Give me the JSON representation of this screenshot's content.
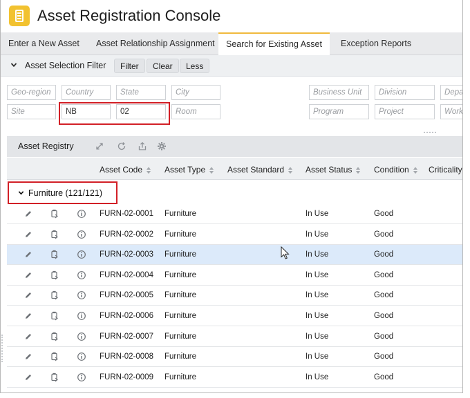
{
  "app": {
    "title": "Asset Registration Console",
    "logo_icon": "document-list-icon",
    "accent_color": "#f2c230"
  },
  "tabs": [
    {
      "label": "Enter a New Asset",
      "active": false
    },
    {
      "label": "Asset Relationship Assignment",
      "active": false
    },
    {
      "label": "Search for Existing Asset",
      "active": true
    },
    {
      "label": "Exception Reports",
      "active": false
    }
  ],
  "filter_bar": {
    "label": "Asset Selection Filter",
    "buttons": {
      "filter": "Filter",
      "clear": "Clear",
      "less": "Less"
    }
  },
  "filter_fields": {
    "geo_region": {
      "value": "",
      "placeholder": "Geo-region"
    },
    "country": {
      "value": "",
      "placeholder": "Country"
    },
    "state": {
      "value": "",
      "placeholder": "State"
    },
    "city": {
      "value": "",
      "placeholder": "City"
    },
    "business_unit": {
      "value": "",
      "placeholder": "Business Unit"
    },
    "division": {
      "value": "",
      "placeholder": "Division"
    },
    "department": {
      "value": "",
      "placeholder": "Depa"
    },
    "site": {
      "value": "",
      "placeholder": "Site"
    },
    "nb": {
      "value": "NB",
      "placeholder": ""
    },
    "code": {
      "value": "02",
      "placeholder": ""
    },
    "room": {
      "value": "",
      "placeholder": "Room"
    },
    "program": {
      "value": "",
      "placeholder": "Program"
    },
    "project": {
      "value": "",
      "placeholder": "Project"
    },
    "work": {
      "value": "",
      "placeholder": "Work"
    }
  },
  "grid": {
    "title": "Asset Registry",
    "toolbar_icons": [
      "expand-icon",
      "refresh-icon",
      "export-icon",
      "settings-gear-icon"
    ],
    "columns": [
      "Asset Code",
      "Asset Type",
      "Asset Standard",
      "Asset Status",
      "Condition",
      "Criticality"
    ],
    "group": {
      "label": "Furniture (121/121)",
      "expanded": true
    },
    "row_icons": [
      "edit-pencil-icon",
      "copy-clipboard-icon",
      "info-icon"
    ],
    "selected_row_index": 2,
    "rows": [
      {
        "code": "FURN-02-0001",
        "type": "Furniture",
        "standard": "",
        "status": "In Use",
        "condition": "Good",
        "criticality": ""
      },
      {
        "code": "FURN-02-0002",
        "type": "Furniture",
        "standard": "",
        "status": "In Use",
        "condition": "Good",
        "criticality": ""
      },
      {
        "code": "FURN-02-0003",
        "type": "Furniture",
        "standard": "",
        "status": "In Use",
        "condition": "Good",
        "criticality": ""
      },
      {
        "code": "FURN-02-0004",
        "type": "Furniture",
        "standard": "",
        "status": "In Use",
        "condition": "Good",
        "criticality": ""
      },
      {
        "code": "FURN-02-0005",
        "type": "Furniture",
        "standard": "",
        "status": "In Use",
        "condition": "Good",
        "criticality": ""
      },
      {
        "code": "FURN-02-0006",
        "type": "Furniture",
        "standard": "",
        "status": "In Use",
        "condition": "Good",
        "criticality": ""
      },
      {
        "code": "FURN-02-0007",
        "type": "Furniture",
        "standard": "",
        "status": "In Use",
        "condition": "Good",
        "criticality": ""
      },
      {
        "code": "FURN-02-0008",
        "type": "Furniture",
        "standard": "",
        "status": "In Use",
        "condition": "Good",
        "criticality": ""
      },
      {
        "code": "FURN-02-0009",
        "type": "Furniture",
        "standard": "",
        "status": "In Use",
        "condition": "Good",
        "criticality": ""
      }
    ]
  },
  "colors": {
    "highlight_box": "#d21f26",
    "selected_row": "#dceafa",
    "active_tab_border": "#f0b93c"
  }
}
